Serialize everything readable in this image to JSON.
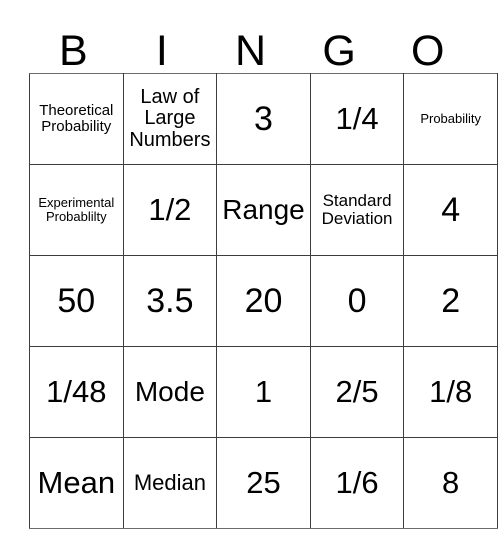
{
  "card": {
    "title_letters": [
      "B",
      "I",
      "N",
      "G",
      "O"
    ],
    "columns": 5,
    "rows": 5,
    "border_color": "#3d3d3d",
    "background_color": "#ffffff",
    "text_color": "#000000",
    "cells": [
      [
        {
          "text": "Theoretical Probability",
          "size": "sm"
        },
        {
          "text": "Law of Large Numbers",
          "size": "lg"
        },
        {
          "text": "3",
          "size": "4xl"
        },
        {
          "text": "1/4",
          "size": "3xl"
        },
        {
          "text": "Probability",
          "size": "xs"
        }
      ],
      [
        {
          "text": "Experimental Probablilty",
          "size": "xs"
        },
        {
          "text": "1/2",
          "size": "3xl"
        },
        {
          "text": "Range",
          "size": "2xl"
        },
        {
          "text": "Standard Deviation",
          "size": "md"
        },
        {
          "text": "4",
          "size": "4xl"
        }
      ],
      [
        {
          "text": "50",
          "size": "4xl"
        },
        {
          "text": "3.5",
          "size": "4xl"
        },
        {
          "text": "20",
          "size": "4xl"
        },
        {
          "text": "0",
          "size": "4xl"
        },
        {
          "text": "2",
          "size": "4xl"
        }
      ],
      [
        {
          "text": "1/48",
          "size": "3xl"
        },
        {
          "text": "Mode",
          "size": "2xl"
        },
        {
          "text": "1",
          "size": "3xl"
        },
        {
          "text": "2/5",
          "size": "3xl"
        },
        {
          "text": "1/8",
          "size": "3xl"
        }
      ],
      [
        {
          "text": "Mean",
          "size": "3xl"
        },
        {
          "text": "Median",
          "size": "xl"
        },
        {
          "text": "25",
          "size": "3xl"
        },
        {
          "text": "1/6",
          "size": "3xl"
        },
        {
          "text": "8",
          "size": "3xl"
        }
      ]
    ]
  }
}
